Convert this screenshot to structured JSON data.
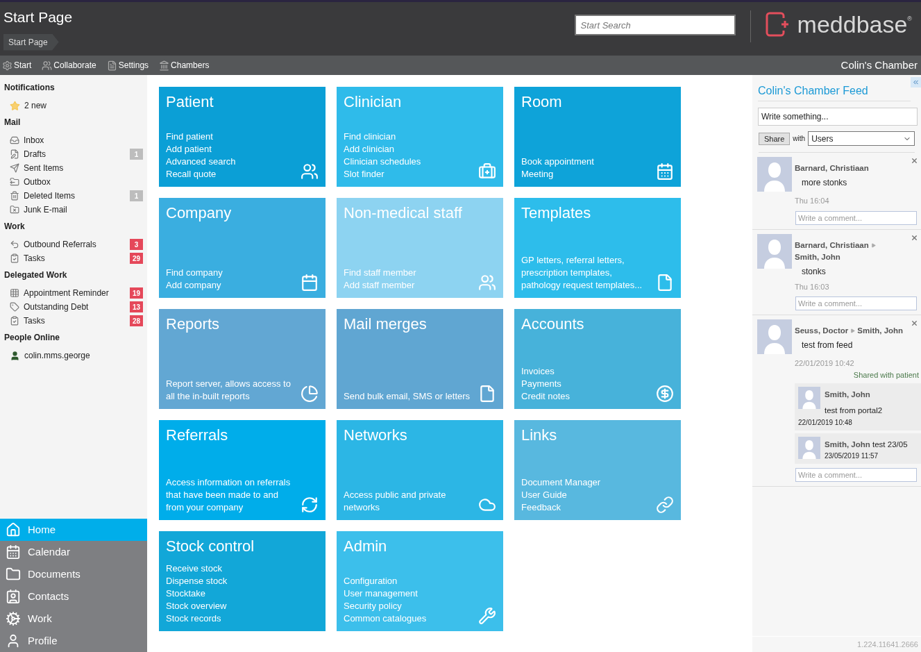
{
  "header": {
    "title": "Start Page",
    "breadcrumb": "Start Page",
    "search": {
      "placeholder": "Start Search"
    },
    "logo": "meddbase",
    "logo_mark": "®"
  },
  "toolbar": {
    "items": [
      "Start",
      "Collaborate",
      "Settings",
      "Chambers"
    ],
    "chamber": "Colin's Chamber"
  },
  "sidebar": {
    "sections": [
      {
        "title": "Notifications",
        "items": [
          {
            "label": "2 new"
          }
        ]
      },
      {
        "title": "Mail",
        "items": [
          {
            "label": "Inbox"
          },
          {
            "label": "Drafts",
            "badge": "1",
            "color": "#bdbdbd"
          },
          {
            "label": "Sent Items"
          },
          {
            "label": "Outbox"
          },
          {
            "label": "Deleted Items",
            "badge": "1",
            "color": "#bdbdbd"
          },
          {
            "label": "Junk E-mail"
          }
        ]
      },
      {
        "title": "Work",
        "items": [
          {
            "label": "Outbound Referrals",
            "badge": "3",
            "color": "#e5485a"
          },
          {
            "label": "Tasks",
            "badge": "29",
            "color": "#e5485a"
          }
        ]
      },
      {
        "title": "Delegated Work",
        "items": [
          {
            "label": "Appointment Reminder",
            "badge": "19",
            "color": "#e5485a"
          },
          {
            "label": "Outstanding Debt",
            "badge": "13",
            "color": "#e5485a"
          },
          {
            "label": "Tasks",
            "badge": "28",
            "color": "#e5485a"
          }
        ]
      },
      {
        "title": "People Online",
        "items": [
          {
            "label": "colin.mms.george"
          }
        ]
      }
    ],
    "nav": [
      {
        "label": "Home",
        "selected": true
      },
      {
        "label": "Calendar",
        "selected": false
      },
      {
        "label": "Documents",
        "selected": false
      },
      {
        "label": "Contacts",
        "selected": false
      },
      {
        "label": "Work",
        "selected": false
      },
      {
        "label": "Profile",
        "selected": false
      }
    ]
  },
  "tiles": [
    {
      "title": "Patient",
      "color": "#0b9fd6",
      "lines": [
        "Find patient",
        "Add patient",
        "Advanced search",
        "Recall quote"
      ]
    },
    {
      "title": "Clinician",
      "color": "#2fbbea",
      "lines": [
        "Find clinician",
        "Add clinician",
        "Clinician schedules",
        "Slot finder"
      ]
    },
    {
      "title": "Room",
      "color": "#0ea3d9",
      "lines": [
        "Book appointment",
        "Meeting"
      ]
    },
    {
      "title": "Company",
      "color": "#3aaee0",
      "lines": [
        "Find company",
        "Add company"
      ]
    },
    {
      "title": "Non-medical staff",
      "color": "#8dd3f1",
      "lines": [
        "Find staff member",
        "Add staff member"
      ]
    },
    {
      "title": "Templates",
      "color": "#2dbdeb",
      "lines": [
        "GP letters, referral letters, prescription templates, pathology request templates..."
      ]
    },
    {
      "title": "Reports",
      "color": "#62a7d3",
      "lines": [
        "Report server, allows access to all the in-built reports"
      ]
    },
    {
      "title": "Mail merges",
      "color": "#60a6d2",
      "lines": [
        "Send bulk email, SMS or letters"
      ]
    },
    {
      "title": "Accounts",
      "color": "#47b2da",
      "lines": [
        "Invoices",
        "Payments",
        "Credit notes"
      ]
    },
    {
      "title": "Referrals",
      "color": "#00adea",
      "lines": [
        "Access information on referrals that have been made to and from your company"
      ]
    },
    {
      "title": "Networks",
      "color": "#2cb6e5",
      "lines": [
        "Access public and private networks"
      ]
    },
    {
      "title": "Links",
      "color": "#58b8df",
      "lines": [
        "Document Manager",
        "User Guide",
        "Feedback"
      ]
    },
    {
      "title": "Stock control",
      "color": "#12a7d8",
      "lines": [
        "Receive stock",
        "Dispense stock",
        "Stocktake",
        "Stock overview",
        "Stock records"
      ]
    },
    {
      "title": "Admin",
      "color": "#3cbfeb",
      "lines": [
        "Configuration",
        "User management",
        "Security policy",
        "Common catalogues"
      ]
    }
  ],
  "feed": {
    "title": "Colin's Chamber Feed",
    "post_placeholder": "Write something...",
    "share_button": "Share",
    "with_label": "with",
    "audience": "Users",
    "posts": [
      {
        "author": "Barnard, Christiaan",
        "text": "more stonks",
        "time": "Thu 16:04",
        "comment_placeholder": "Write a comment..."
      },
      {
        "author": "Barnard, Christiaan",
        "recipient": "Smith, John",
        "text": "stonks",
        "time": "Thu 16:03",
        "comment_placeholder": "Write a comment..."
      },
      {
        "author": "Seuss, Doctor",
        "recipient": "Smith, John",
        "text": "test from feed",
        "time": "22/01/2019 10:42",
        "note": "Shared with patient",
        "replies": [
          {
            "author": "Smith, John",
            "text": "test from portal2",
            "time": "22/01/2019 10:48"
          },
          {
            "author": "Smith, John",
            "text": "test 23/05",
            "time": "23/05/2019 11:57"
          }
        ],
        "comment_placeholder": "Write a comment..."
      }
    ]
  },
  "version": "1.224.11641.2666"
}
